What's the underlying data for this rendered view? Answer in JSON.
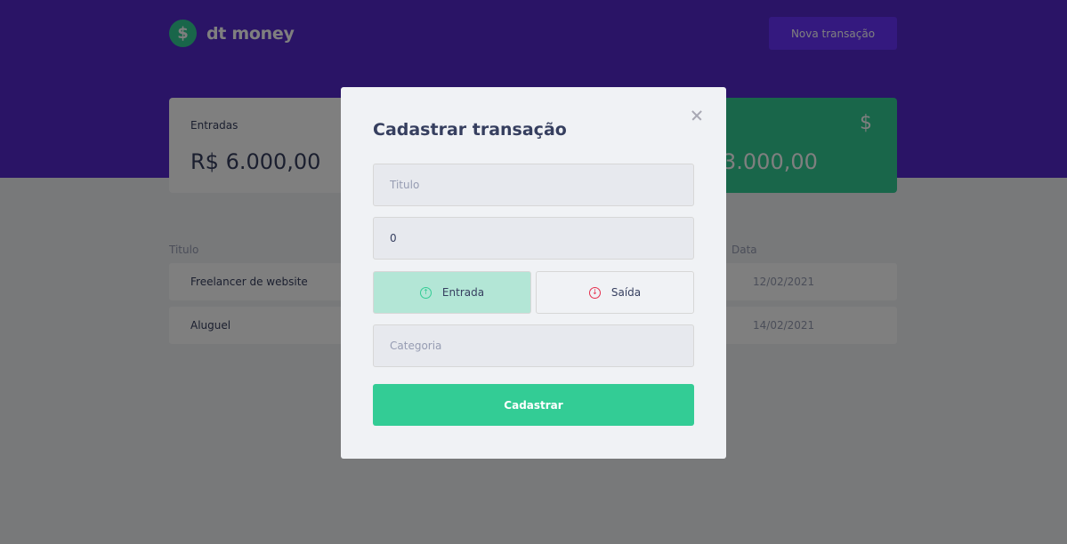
{
  "header": {
    "logo_symbol": "$",
    "app_name": "dt money",
    "new_transaction_label": "Nova transação"
  },
  "summary": {
    "income": {
      "label": "Entradas",
      "value": "R$ 6.000,00"
    },
    "total": {
      "value": "3.000,00",
      "icon": "$"
    }
  },
  "table": {
    "headers": {
      "title": "Titulo",
      "date": "Data"
    },
    "rows": [
      {
        "title": "Freelancer de website",
        "date": "12/02/2021"
      },
      {
        "title": "Aluguel",
        "date": "14/02/2021"
      }
    ]
  },
  "modal": {
    "title": "Cadastrar transação",
    "title_placeholder": "Titulo",
    "amount_value": "0",
    "income_label": "Entrada",
    "income_icon": "↑",
    "outcome_label": "Saída",
    "outcome_icon": "↓",
    "category_placeholder": "Categoria",
    "submit_label": "Cadastrar"
  },
  "colors": {
    "header": "#5429cc",
    "accent_button": "#6933ff",
    "green": "#33cc95",
    "red": "#e52e4d",
    "background": "#f0f2f5"
  }
}
